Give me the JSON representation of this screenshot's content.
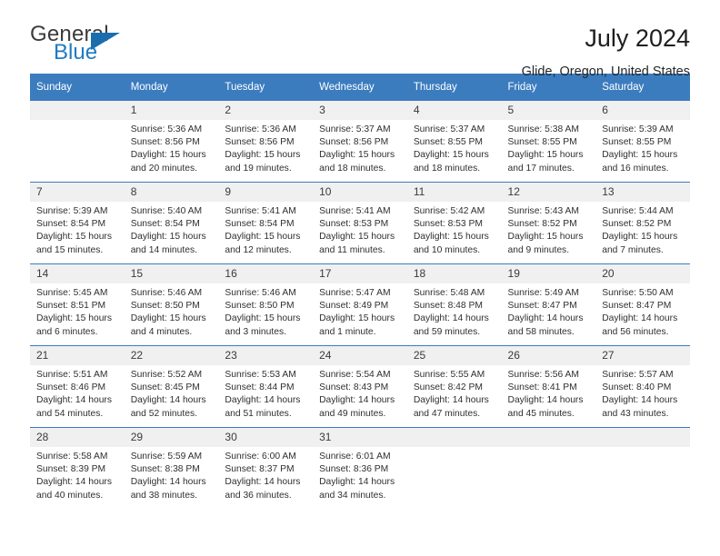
{
  "brand": {
    "name_top": "General",
    "name_bottom": "Blue",
    "triangle_color": "#1a6ead",
    "blue_color": "#1f7bc1"
  },
  "header": {
    "title": "July 2024",
    "subtitle": "Glide, Oregon, United States"
  },
  "theme": {
    "header_bg": "#3b7cbf",
    "daynum_bg": "#f0f0f0",
    "week_separator": "#3b7cbf"
  },
  "weekday_headers": [
    "Sunday",
    "Monday",
    "Tuesday",
    "Wednesday",
    "Thursday",
    "Friday",
    "Saturday"
  ],
  "weeks": [
    [
      {
        "day": "",
        "sunrise": "",
        "sunset": "",
        "daylight_line1": "",
        "daylight_line2": ""
      },
      {
        "day": "1",
        "sunrise": "Sunrise: 5:36 AM",
        "sunset": "Sunset: 8:56 PM",
        "daylight_line1": "Daylight: 15 hours",
        "daylight_line2": "and 20 minutes."
      },
      {
        "day": "2",
        "sunrise": "Sunrise: 5:36 AM",
        "sunset": "Sunset: 8:56 PM",
        "daylight_line1": "Daylight: 15 hours",
        "daylight_line2": "and 19 minutes."
      },
      {
        "day": "3",
        "sunrise": "Sunrise: 5:37 AM",
        "sunset": "Sunset: 8:56 PM",
        "daylight_line1": "Daylight: 15 hours",
        "daylight_line2": "and 18 minutes."
      },
      {
        "day": "4",
        "sunrise": "Sunrise: 5:37 AM",
        "sunset": "Sunset: 8:55 PM",
        "daylight_line1": "Daylight: 15 hours",
        "daylight_line2": "and 18 minutes."
      },
      {
        "day": "5",
        "sunrise": "Sunrise: 5:38 AM",
        "sunset": "Sunset: 8:55 PM",
        "daylight_line1": "Daylight: 15 hours",
        "daylight_line2": "and 17 minutes."
      },
      {
        "day": "6",
        "sunrise": "Sunrise: 5:39 AM",
        "sunset": "Sunset: 8:55 PM",
        "daylight_line1": "Daylight: 15 hours",
        "daylight_line2": "and 16 minutes."
      }
    ],
    [
      {
        "day": "7",
        "sunrise": "Sunrise: 5:39 AM",
        "sunset": "Sunset: 8:54 PM",
        "daylight_line1": "Daylight: 15 hours",
        "daylight_line2": "and 15 minutes."
      },
      {
        "day": "8",
        "sunrise": "Sunrise: 5:40 AM",
        "sunset": "Sunset: 8:54 PM",
        "daylight_line1": "Daylight: 15 hours",
        "daylight_line2": "and 14 minutes."
      },
      {
        "day": "9",
        "sunrise": "Sunrise: 5:41 AM",
        "sunset": "Sunset: 8:54 PM",
        "daylight_line1": "Daylight: 15 hours",
        "daylight_line2": "and 12 minutes."
      },
      {
        "day": "10",
        "sunrise": "Sunrise: 5:41 AM",
        "sunset": "Sunset: 8:53 PM",
        "daylight_line1": "Daylight: 15 hours",
        "daylight_line2": "and 11 minutes."
      },
      {
        "day": "11",
        "sunrise": "Sunrise: 5:42 AM",
        "sunset": "Sunset: 8:53 PM",
        "daylight_line1": "Daylight: 15 hours",
        "daylight_line2": "and 10 minutes."
      },
      {
        "day": "12",
        "sunrise": "Sunrise: 5:43 AM",
        "sunset": "Sunset: 8:52 PM",
        "daylight_line1": "Daylight: 15 hours",
        "daylight_line2": "and 9 minutes."
      },
      {
        "day": "13",
        "sunrise": "Sunrise: 5:44 AM",
        "sunset": "Sunset: 8:52 PM",
        "daylight_line1": "Daylight: 15 hours",
        "daylight_line2": "and 7 minutes."
      }
    ],
    [
      {
        "day": "14",
        "sunrise": "Sunrise: 5:45 AM",
        "sunset": "Sunset: 8:51 PM",
        "daylight_line1": "Daylight: 15 hours",
        "daylight_line2": "and 6 minutes."
      },
      {
        "day": "15",
        "sunrise": "Sunrise: 5:46 AM",
        "sunset": "Sunset: 8:50 PM",
        "daylight_line1": "Daylight: 15 hours",
        "daylight_line2": "and 4 minutes."
      },
      {
        "day": "16",
        "sunrise": "Sunrise: 5:46 AM",
        "sunset": "Sunset: 8:50 PM",
        "daylight_line1": "Daylight: 15 hours",
        "daylight_line2": "and 3 minutes."
      },
      {
        "day": "17",
        "sunrise": "Sunrise: 5:47 AM",
        "sunset": "Sunset: 8:49 PM",
        "daylight_line1": "Daylight: 15 hours",
        "daylight_line2": "and 1 minute."
      },
      {
        "day": "18",
        "sunrise": "Sunrise: 5:48 AM",
        "sunset": "Sunset: 8:48 PM",
        "daylight_line1": "Daylight: 14 hours",
        "daylight_line2": "and 59 minutes."
      },
      {
        "day": "19",
        "sunrise": "Sunrise: 5:49 AM",
        "sunset": "Sunset: 8:47 PM",
        "daylight_line1": "Daylight: 14 hours",
        "daylight_line2": "and 58 minutes."
      },
      {
        "day": "20",
        "sunrise": "Sunrise: 5:50 AM",
        "sunset": "Sunset: 8:47 PM",
        "daylight_line1": "Daylight: 14 hours",
        "daylight_line2": "and 56 minutes."
      }
    ],
    [
      {
        "day": "21",
        "sunrise": "Sunrise: 5:51 AM",
        "sunset": "Sunset: 8:46 PM",
        "daylight_line1": "Daylight: 14 hours",
        "daylight_line2": "and 54 minutes."
      },
      {
        "day": "22",
        "sunrise": "Sunrise: 5:52 AM",
        "sunset": "Sunset: 8:45 PM",
        "daylight_line1": "Daylight: 14 hours",
        "daylight_line2": "and 52 minutes."
      },
      {
        "day": "23",
        "sunrise": "Sunrise: 5:53 AM",
        "sunset": "Sunset: 8:44 PM",
        "daylight_line1": "Daylight: 14 hours",
        "daylight_line2": "and 51 minutes."
      },
      {
        "day": "24",
        "sunrise": "Sunrise: 5:54 AM",
        "sunset": "Sunset: 8:43 PM",
        "daylight_line1": "Daylight: 14 hours",
        "daylight_line2": "and 49 minutes."
      },
      {
        "day": "25",
        "sunrise": "Sunrise: 5:55 AM",
        "sunset": "Sunset: 8:42 PM",
        "daylight_line1": "Daylight: 14 hours",
        "daylight_line2": "and 47 minutes."
      },
      {
        "day": "26",
        "sunrise": "Sunrise: 5:56 AM",
        "sunset": "Sunset: 8:41 PM",
        "daylight_line1": "Daylight: 14 hours",
        "daylight_line2": "and 45 minutes."
      },
      {
        "day": "27",
        "sunrise": "Sunrise: 5:57 AM",
        "sunset": "Sunset: 8:40 PM",
        "daylight_line1": "Daylight: 14 hours",
        "daylight_line2": "and 43 minutes."
      }
    ],
    [
      {
        "day": "28",
        "sunrise": "Sunrise: 5:58 AM",
        "sunset": "Sunset: 8:39 PM",
        "daylight_line1": "Daylight: 14 hours",
        "daylight_line2": "and 40 minutes."
      },
      {
        "day": "29",
        "sunrise": "Sunrise: 5:59 AM",
        "sunset": "Sunset: 8:38 PM",
        "daylight_line1": "Daylight: 14 hours",
        "daylight_line2": "and 38 minutes."
      },
      {
        "day": "30",
        "sunrise": "Sunrise: 6:00 AM",
        "sunset": "Sunset: 8:37 PM",
        "daylight_line1": "Daylight: 14 hours",
        "daylight_line2": "and 36 minutes."
      },
      {
        "day": "31",
        "sunrise": "Sunrise: 6:01 AM",
        "sunset": "Sunset: 8:36 PM",
        "daylight_line1": "Daylight: 14 hours",
        "daylight_line2": "and 34 minutes."
      },
      {
        "day": "",
        "sunrise": "",
        "sunset": "",
        "daylight_line1": "",
        "daylight_line2": ""
      },
      {
        "day": "",
        "sunrise": "",
        "sunset": "",
        "daylight_line1": "",
        "daylight_line2": ""
      },
      {
        "day": "",
        "sunrise": "",
        "sunset": "",
        "daylight_line1": "",
        "daylight_line2": ""
      }
    ]
  ]
}
